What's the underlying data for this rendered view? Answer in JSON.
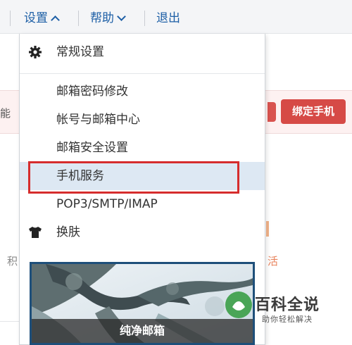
{
  "nav": {
    "settings": "设置",
    "help": "帮助",
    "logout": "退出"
  },
  "background": {
    "left_text": "能",
    "left_text2": "积",
    "bind_phone_button": "绑定手机",
    "activate_text": "活"
  },
  "menu": {
    "general": "常规设置",
    "items": [
      "邮箱密码修改",
      "帐号与邮箱中心",
      "邮箱安全设置",
      "手机服务",
      "POP3/SMTP/IMAP"
    ],
    "skin": "换肤",
    "selected_index": 3
  },
  "skin_preview": {
    "label": "纯净邮箱"
  },
  "watermark": {
    "title": "百科全说",
    "subtitle": "助你轻松解决"
  },
  "colors": {
    "nav_link": "#1d5fa6",
    "highlight_border": "#d62d2d",
    "selected_bg": "#dde8f3",
    "bind_button": "#d64a46"
  },
  "icons": {
    "general": "gear-icon",
    "skin": "tshirt-icon"
  }
}
